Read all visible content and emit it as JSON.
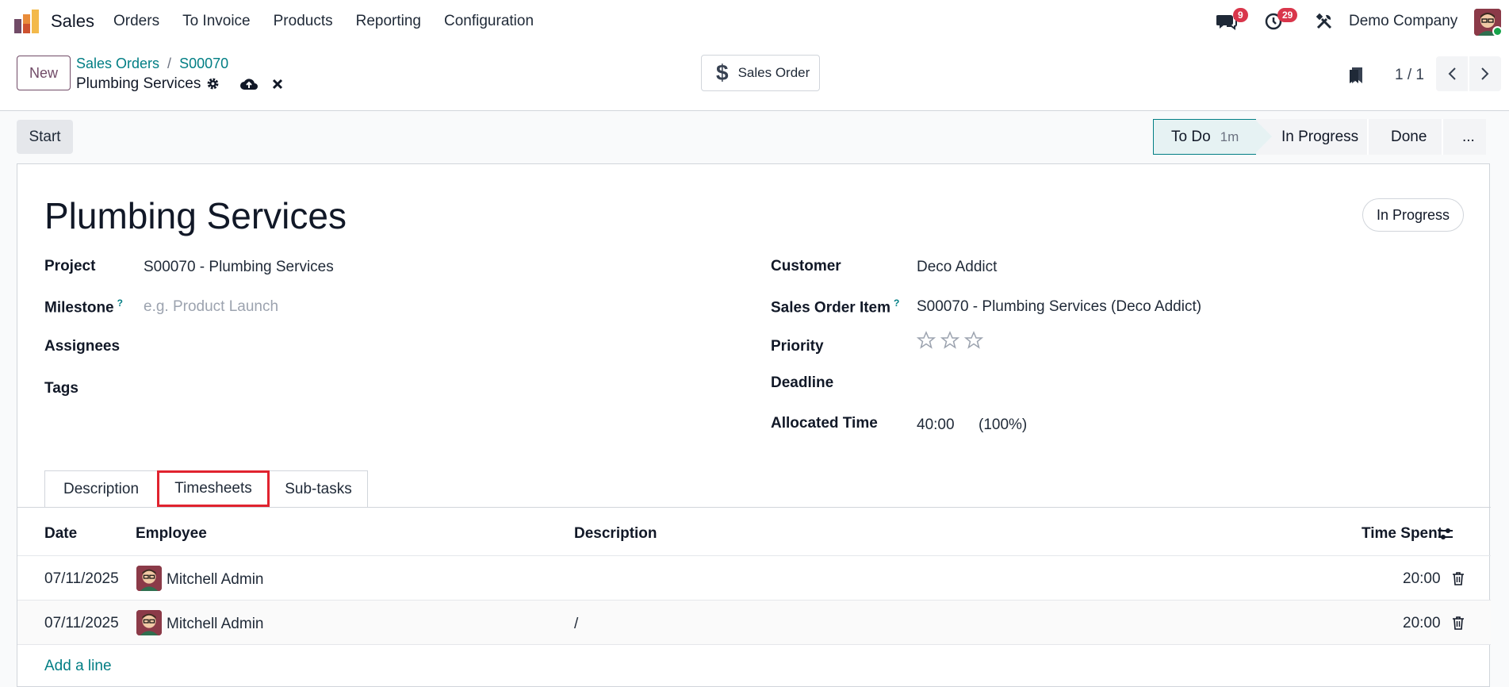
{
  "navbar": {
    "app_name": "Sales",
    "menu": [
      "Orders",
      "To Invoice",
      "Products",
      "Reporting",
      "Configuration"
    ],
    "messages_count": "9",
    "activities_count": "29",
    "company": "Demo Company"
  },
  "control": {
    "new_label": "New",
    "breadcrumb": [
      "Sales Orders",
      "S00070"
    ],
    "record_name": "Plumbing Services",
    "smart_button": "Sales Order",
    "pager": "1 / 1"
  },
  "statusbar": {
    "start_label": "Start",
    "stages": [
      {
        "label": "To Do",
        "duration": "1m",
        "active": true
      },
      {
        "label": "In Progress"
      },
      {
        "label": "Done"
      },
      {
        "label": "..."
      }
    ]
  },
  "form": {
    "title": "Plumbing Services",
    "state": "In Progress",
    "left_fields": [
      {
        "label": "Project",
        "value": "S00070 - Plumbing Services"
      },
      {
        "label": "Milestone",
        "help": "?",
        "placeholder": "e.g. Product Launch"
      },
      {
        "label": "Assignees",
        "value": ""
      },
      {
        "label": "Tags",
        "value": ""
      }
    ],
    "right_fields": [
      {
        "label": "Customer",
        "value": "Deco Addict"
      },
      {
        "label": "Sales Order Item",
        "help": "?",
        "value": "S00070 - Plumbing Services (Deco Addict)"
      },
      {
        "label": "Priority",
        "stars": 0,
        "max_stars": 3
      },
      {
        "label": "Deadline",
        "value": ""
      },
      {
        "label": "Allocated Time",
        "value": "40:00",
        "extra": "(100%)"
      }
    ]
  },
  "tabs": [
    "Description",
    "Timesheets",
    "Sub-tasks"
  ],
  "timesheets": {
    "columns": [
      "Date",
      "Employee",
      "Description",
      "Time Spent"
    ],
    "rows": [
      {
        "date": "07/11/2025",
        "employee": "Mitchell Admin",
        "description": "",
        "time": "20:00"
      },
      {
        "date": "07/11/2025",
        "employee": "Mitchell Admin",
        "description": "/",
        "time": "20:00"
      }
    ],
    "add_line": "Add a line"
  },
  "colors": {
    "brand": "#714b67",
    "link": "#017e84",
    "badge": "#d9364b",
    "highlight": "#e0232f"
  }
}
